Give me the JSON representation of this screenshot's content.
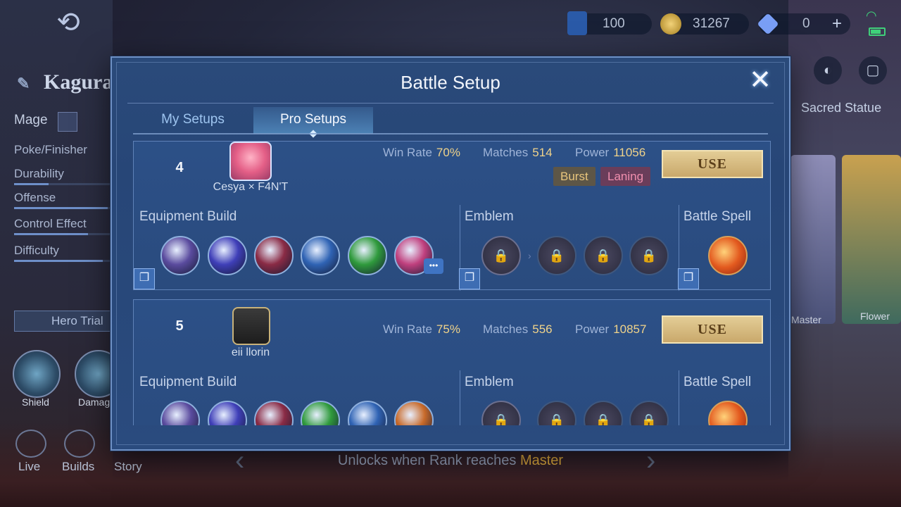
{
  "background": {
    "currencies": [
      {
        "name": "m-token-icon",
        "value": "100",
        "color": "#3a8be0"
      },
      {
        "name": "gold-coin-icon",
        "value": "31267",
        "color": "#d4a93a"
      },
      {
        "name": "diamond-icon",
        "value": "0",
        "color": "#7a9ff6"
      }
    ],
    "hero": {
      "name": "Kagura",
      "role": "Mage",
      "specialty": "Poke/Finisher",
      "stats": [
        {
          "label": "Durability",
          "value": 0.35
        },
        {
          "label": "Offense",
          "value": 0.95
        },
        {
          "label": "Control Effect",
          "value": 0.75
        },
        {
          "label": "Difficulty",
          "value": 0.9
        }
      ],
      "hero_trial": "Hero Trial",
      "skills": [
        "Shield",
        "Damage"
      ]
    },
    "bottom_nav": [
      "Live",
      "Builds",
      "Story"
    ],
    "sacred_statue": "Sacred Statue",
    "skin_labels": [
      "Master",
      "Flower"
    ],
    "unlock_text": "Unlocks when Rank reaches",
    "unlock_rank": "Master"
  },
  "modal": {
    "title": "Battle Setup",
    "tabs": [
      "My Setups",
      "Pro Setups"
    ],
    "active_tab": "Pro Setups",
    "labels": {
      "win_rate": "Win Rate",
      "matches": "Matches",
      "power": "Power",
      "use": "USE",
      "equipment": "Equipment Build",
      "emblem": "Emblem",
      "spell": "Battle Spell"
    },
    "setups": [
      {
        "rank": "4",
        "player": "Cesya × F4N'T",
        "win_rate": "70%",
        "matches": "514",
        "power": "11056",
        "tags": [
          "Burst",
          "Laning"
        ],
        "items": [
          "#5a4b9e",
          "#3f3fb8",
          "#8a2b45",
          "#2f63b4",
          "#2f9a3c",
          "#c0407e"
        ],
        "spell_name": "Flameshot"
      },
      {
        "rank": "5",
        "player": "eii llorin",
        "win_rate": "75%",
        "matches": "556",
        "power": "10857",
        "tags": [],
        "items": [
          "#5a4b9e",
          "#3f3fb8",
          "#8a2b45",
          "#2f9a3c",
          "#2f63b4",
          "#c86a2a"
        ],
        "spell_name": "Flameshot"
      }
    ]
  }
}
